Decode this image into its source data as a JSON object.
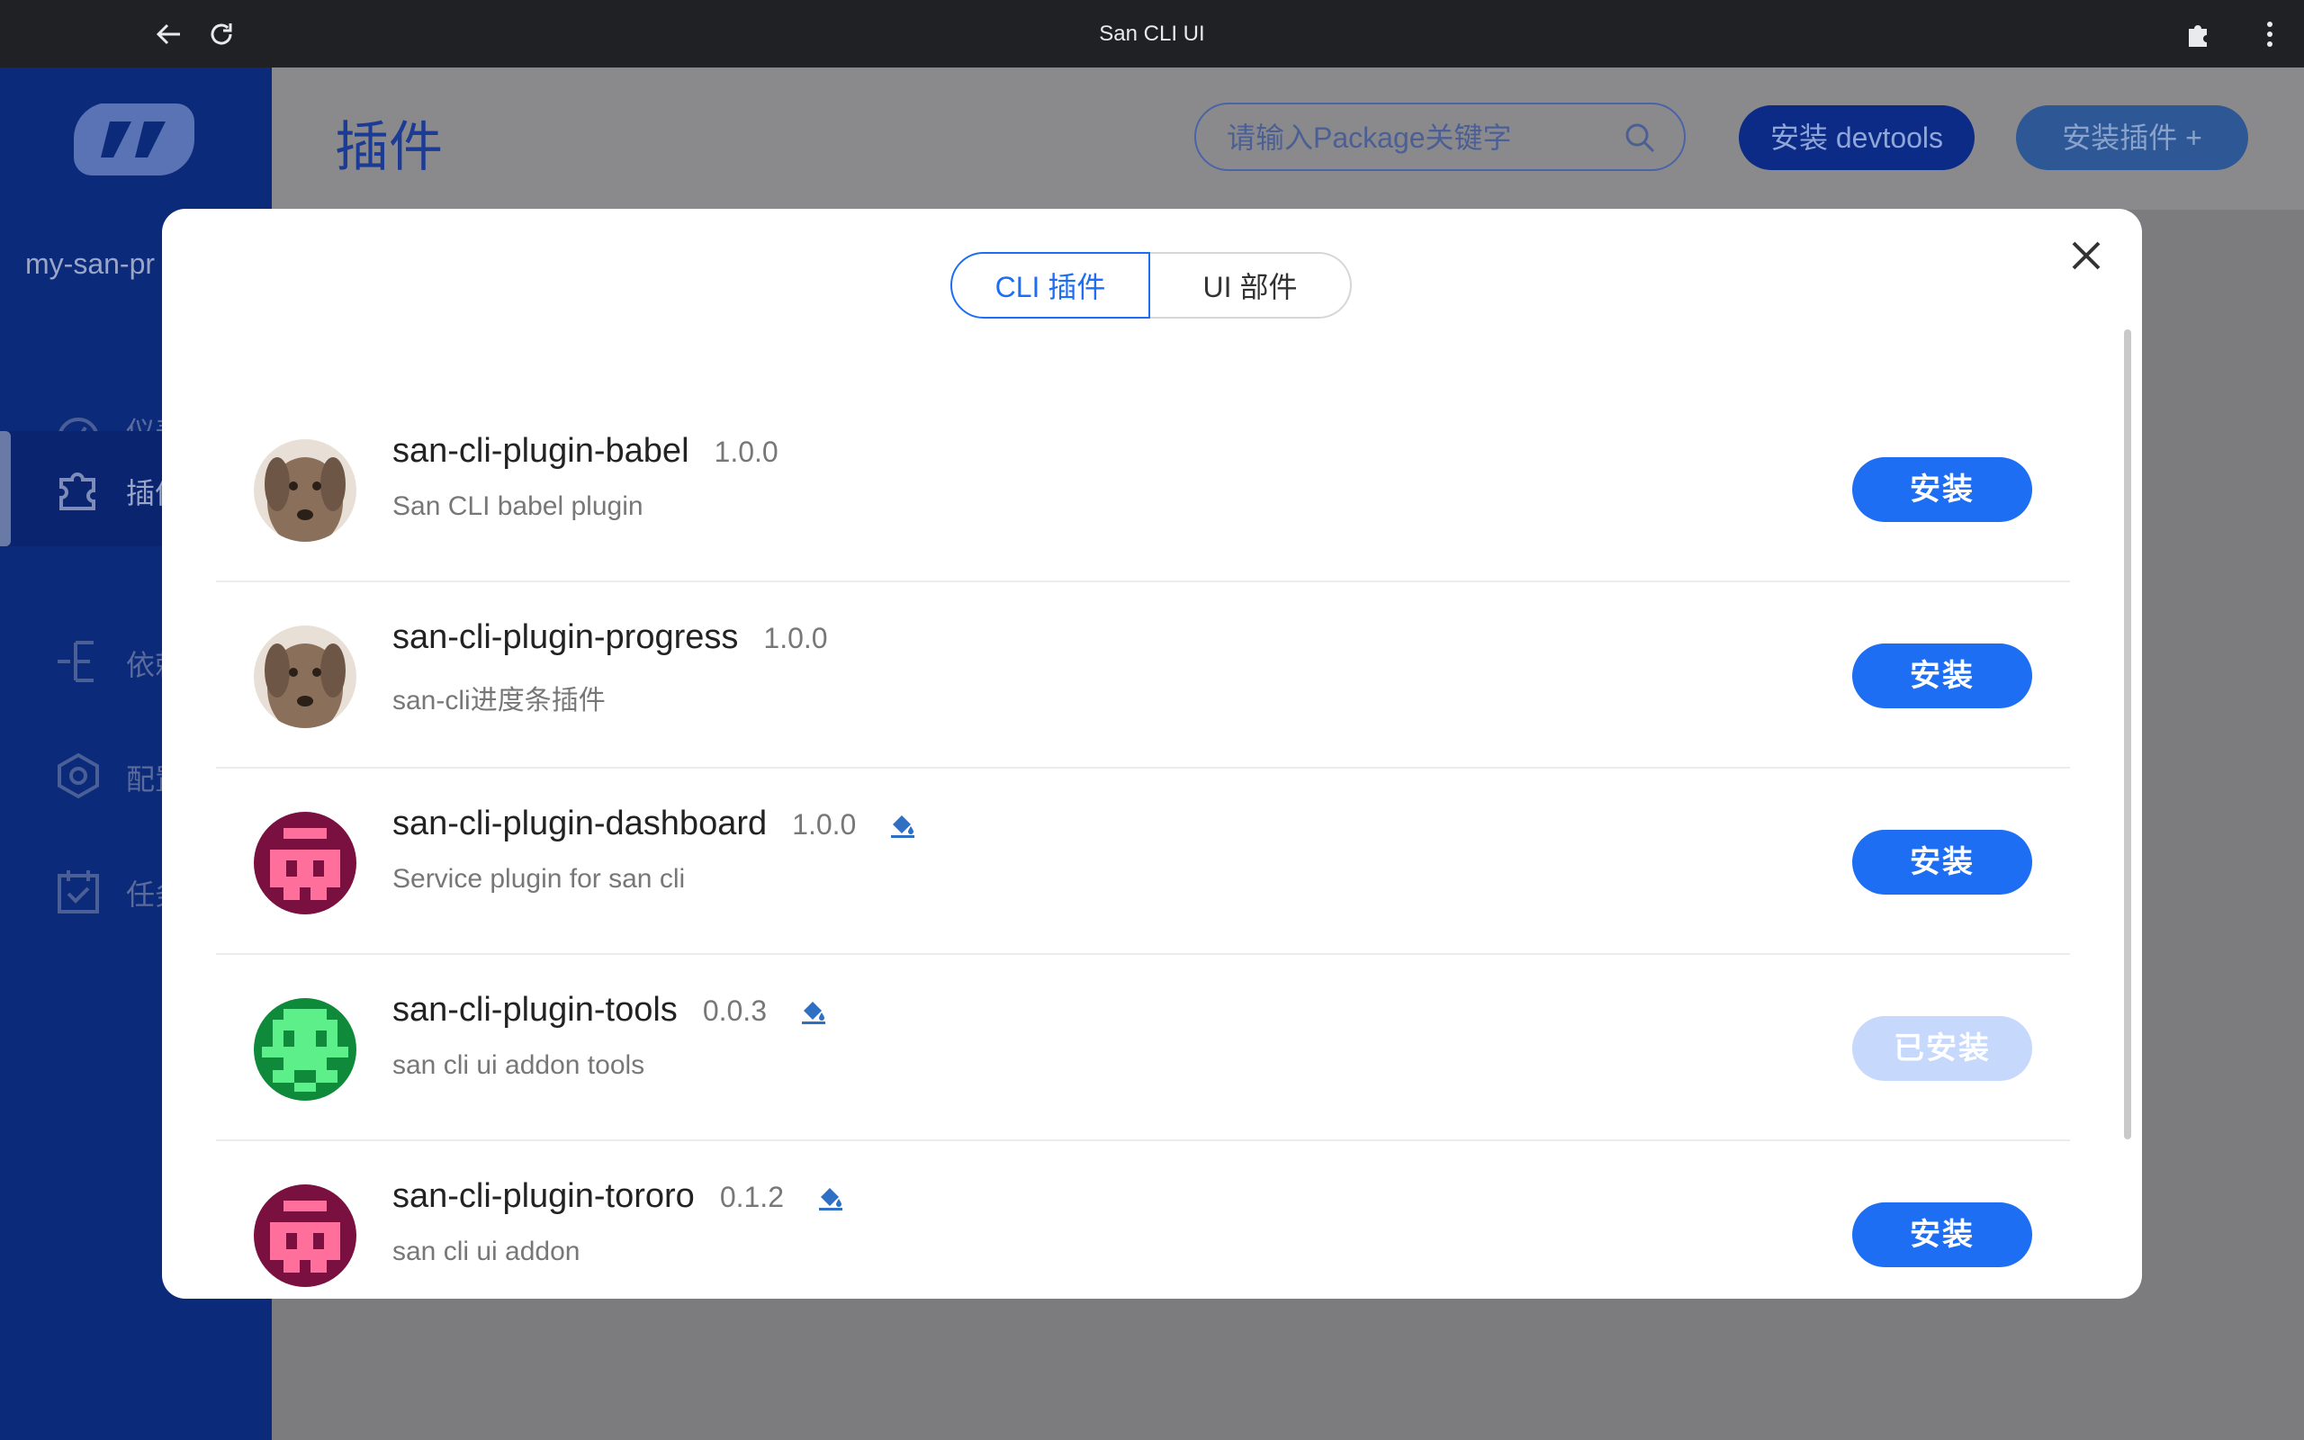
{
  "browser": {
    "title": "San CLI UI"
  },
  "sidebar": {
    "project_name": "my-san-pr",
    "items": [
      {
        "label": "仪表",
        "icon": "dashboard-icon"
      },
      {
        "label": "插件",
        "icon": "puzzle-icon"
      },
      {
        "label": "依赖",
        "icon": "dependency-icon"
      },
      {
        "label": "配置",
        "icon": "hexagon-icon"
      },
      {
        "label": "任务",
        "icon": "calendar-icon"
      }
    ]
  },
  "header": {
    "title": "插件",
    "search_placeholder": "请输入Package关键字",
    "devtools_button": "安装 devtools",
    "install_plugin_button": "安装插件 +"
  },
  "modal": {
    "tabs": [
      {
        "label": "CLI 插件",
        "active": true
      },
      {
        "label": "UI 部件",
        "active": false
      }
    ],
    "plugins": [
      {
        "name": "san-cli-plugin-babel",
        "version": "1.0.0",
        "description": "San CLI babel plugin",
        "ui_badge": false,
        "button": "安装",
        "installed": false,
        "avatar": "dog"
      },
      {
        "name": "san-cli-plugin-progress",
        "version": "1.0.0",
        "description": "san-cli进度条插件",
        "ui_badge": false,
        "button": "安装",
        "installed": false,
        "avatar": "dog"
      },
      {
        "name": "san-cli-plugin-dashboard",
        "version": "1.0.0",
        "description": "Service plugin for san cli",
        "ui_badge": true,
        "button": "安装",
        "installed": false,
        "avatar": "pink-identicon"
      },
      {
        "name": "san-cli-plugin-tools",
        "version": "0.0.3",
        "description": "san cli ui addon tools",
        "ui_badge": true,
        "button": "已安装",
        "installed": true,
        "avatar": "green-identicon"
      },
      {
        "name": "san-cli-plugin-tororo",
        "version": "0.1.2",
        "description": "san cli ui addon",
        "ui_badge": true,
        "button": "安装",
        "installed": false,
        "avatar": "pink-identicon"
      }
    ]
  },
  "colors": {
    "primary": "#1e6ef4",
    "installed": "#c6d8fb",
    "sidebar": "#0c2a7a"
  }
}
